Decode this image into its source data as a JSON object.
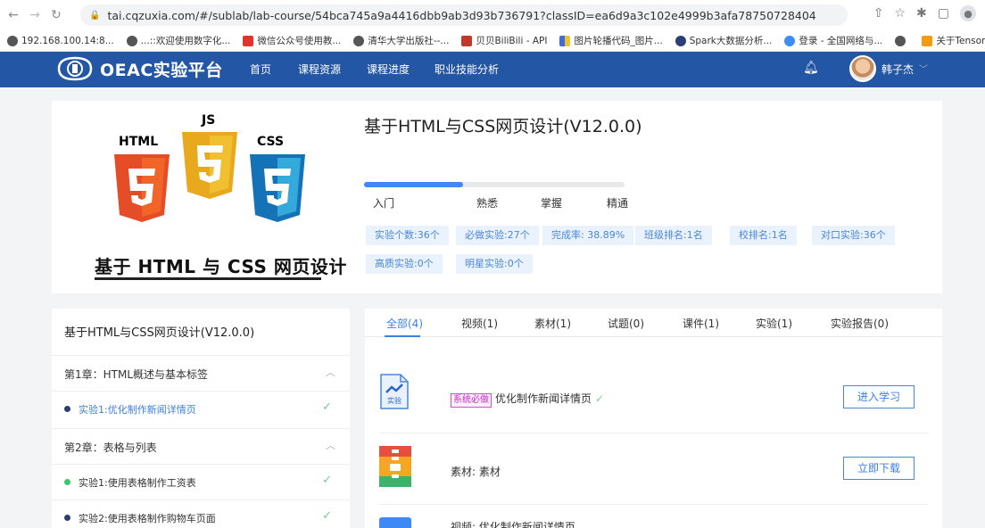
{
  "browser": {
    "url": "tai.cqzuxia.com/#/sublab/lab-course/54bca745a9a4416dbb9ab3d93b736791?classID=ea6d9a3c102e4999b3afa78750728404",
    "bookmarks": [
      "192.168.100.14:8...",
      "...::欢迎使用数字化...",
      "微信公众号使用教...",
      "清华大学出版社--...",
      "贝贝BiliBili - API",
      "图片轮播代码_图片...",
      "Spark大数据分析...",
      "登录 - 全国网络与...",
      "",
      "关于TensorFlow |..."
    ]
  },
  "nav": {
    "brand": "OEAC实验平台",
    "items": [
      "首页",
      "课程资源",
      "课程进度",
      "职业技能分析"
    ],
    "user": "韩子杰"
  },
  "course": {
    "cover": {
      "html": "HTML",
      "js": "JS",
      "css": "CSS",
      "caption": "基于 HTML 与 CSS 网页设计"
    },
    "title": "基于HTML与CSS网页设计(V12.0.0)",
    "progress": 0.38,
    "levels": [
      "入门",
      "熟悉",
      "掌握",
      "精通"
    ],
    "tags": [
      "实验个数:36个",
      "必做实验:27个",
      "完成率: 38.89%",
      "班级排名:1名",
      "校排名:1名",
      "对口实验:36个",
      "高质实验:0个",
      "明星实验:0个"
    ]
  },
  "sidebar": {
    "title": "基于HTML与CSS网页设计(V12.0.0)",
    "chapter1": "第1章：HTML概述与基本标签",
    "lab1_1": "实验1:优化制作新闻详情页",
    "chapter2": "第2章：表格与列表",
    "lab2_1": "实验1:使用表格制作工资表",
    "lab2_2": "实验2:使用表格制作购物车页面"
  },
  "main": {
    "tabs": [
      "全部(4)",
      "视频(1)",
      "素材(1)",
      "试题(0)",
      "课件(1)",
      "实验(1)",
      "实验报告(0)"
    ],
    "items": [
      {
        "badge": "系统必做",
        "label": "优化制作新闻详情页",
        "button": "进入学习",
        "icon_text": "实验"
      },
      {
        "label": "素材: 素材",
        "button": "立即下载"
      },
      {
        "label": "视频: 优化制作新闻详情页"
      }
    ]
  }
}
